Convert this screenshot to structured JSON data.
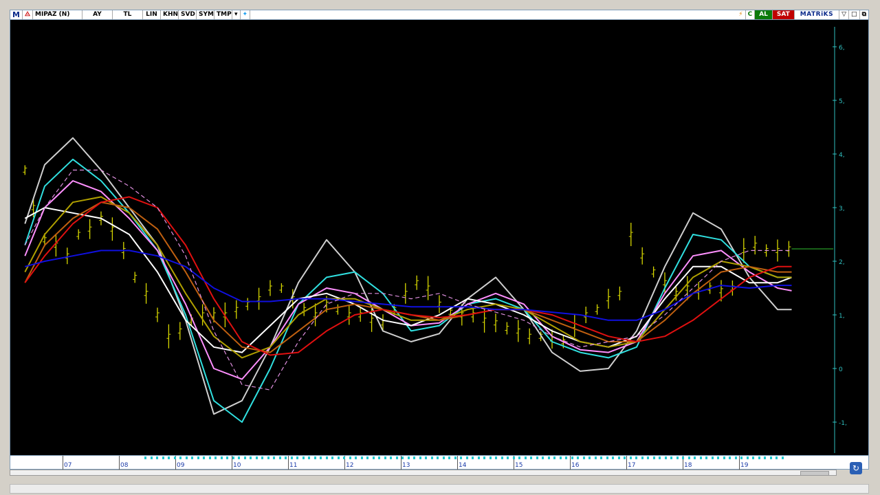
{
  "toolbar": {
    "logo": "M",
    "symbol": "MIPAZ (N)",
    "period": "AY",
    "currency": "TL",
    "buttons": [
      "LIN",
      "KHN",
      "SVD",
      "SYM",
      "TMP"
    ],
    "buy": "AL",
    "sell": "SAT",
    "brand": "MATRiKS"
  },
  "colors": {
    "bars": "#d8d800",
    "red": "#e01010",
    "blue": "#1010e0",
    "cyan": "#30e0e0",
    "white": "#ffffff",
    "gray": "#cfcfcf",
    "pink": "#ff90ff",
    "olive": "#b0a000",
    "brown": "#c06010",
    "dashed": "#e090e0",
    "axis": "#30c0c0",
    "lastvalue": "#30c030"
  },
  "x_labels": [
    "07",
    "08",
    "09",
    "10",
    "11",
    "12",
    "13",
    "14",
    "15",
    "16",
    "17",
    "18",
    "19"
  ],
  "chart_data": {
    "type": "line",
    "ylim": [
      -1.5,
      6.8
    ],
    "y_ticks": [
      "6,",
      "5,",
      "4,",
      "3,",
      "2,",
      "1,",
      "0",
      "-1,"
    ],
    "y_tick_values": [
      6,
      5,
      4,
      3,
      2,
      1,
      0,
      -1
    ],
    "x_range": [
      6.1,
      19.8
    ],
    "last_value": 2.23,
    "price": {
      "x": [
        6.15,
        6.3,
        6.5,
        6.7,
        6.9,
        7.1,
        7.3,
        7.5,
        7.7,
        7.9,
        8.1,
        8.3,
        8.5,
        8.7,
        8.9,
        9.1,
        9.3,
        9.5,
        9.7,
        9.9,
        10.1,
        10.3,
        10.5,
        10.7,
        10.9,
        11.1,
        11.3,
        11.5,
        11.7,
        11.9,
        12.1,
        12.3,
        12.5,
        12.7,
        12.9,
        13.1,
        13.3,
        13.5,
        13.7,
        13.9,
        14.1,
        14.3,
        14.5,
        14.7,
        14.9,
        15.1,
        15.3,
        15.5,
        15.7,
        15.9,
        16.1,
        16.3,
        16.5,
        16.7,
        16.9,
        17.1,
        17.3,
        17.5,
        17.7,
        17.9,
        18.1,
        18.3,
        18.5,
        18.7,
        18.9,
        19.1,
        19.3,
        19.5,
        19.7
      ],
      "y": [
        3.7,
        3.0,
        2.4,
        2.3,
        2.1,
        2.5,
        2.6,
        2.8,
        2.6,
        2.2,
        1.7,
        1.4,
        1.0,
        0.6,
        0.7,
        0.9,
        1.0,
        1.0,
        1.0,
        1.1,
        1.2,
        1.3,
        1.5,
        1.5,
        1.3,
        1.1,
        1.0,
        1.2,
        1.1,
        1.0,
        1.0,
        0.9,
        0.85,
        1.1,
        1.4,
        1.6,
        1.5,
        1.2,
        1.05,
        1.0,
        1.0,
        0.9,
        0.85,
        0.75,
        0.7,
        0.6,
        0.6,
        0.55,
        0.5,
        0.8,
        1.0,
        1.1,
        1.3,
        1.4,
        2.5,
        2.1,
        1.8,
        1.6,
        1.4,
        1.5,
        1.45,
        1.5,
        1.45,
        1.5,
        2.2,
        2.3,
        2.2,
        2.2,
        2.23
      ]
    },
    "series": [
      {
        "color_key": "gray",
        "x": [
          6.15,
          6.5,
          7.0,
          7.5,
          8.0,
          8.5,
          9.0,
          9.5,
          10.0,
          10.5,
          11.0,
          11.5,
          12.0,
          12.5,
          13.0,
          13.5,
          14.0,
          14.5,
          15.0,
          15.5,
          16.0,
          16.5,
          17.0,
          17.5,
          18.0,
          18.5,
          19.0,
          19.5,
          19.75
        ],
        "y": [
          2.7,
          3.8,
          4.3,
          3.7,
          3.0,
          2.3,
          0.9,
          -0.85,
          -0.6,
          0.4,
          1.6,
          2.4,
          1.8,
          0.7,
          0.5,
          0.65,
          1.3,
          1.7,
          1.1,
          0.3,
          -0.05,
          0.0,
          0.7,
          1.9,
          2.9,
          2.6,
          1.7,
          1.1,
          1.1
        ]
      },
      {
        "color_key": "cyan",
        "x": [
          6.15,
          6.5,
          7.0,
          7.5,
          8.0,
          8.5,
          9.0,
          9.5,
          10.0,
          10.5,
          11.0,
          11.5,
          12.0,
          12.5,
          13.0,
          13.5,
          14.0,
          14.5,
          15.0,
          15.5,
          16.0,
          16.5,
          17.0,
          17.5,
          18.0,
          18.5,
          19.0,
          19.5,
          19.75
        ],
        "y": [
          2.3,
          3.4,
          3.9,
          3.5,
          2.9,
          2.2,
          1.0,
          -0.6,
          -1.0,
          0.0,
          1.2,
          1.7,
          1.8,
          1.4,
          0.7,
          0.8,
          1.2,
          1.3,
          1.1,
          0.5,
          0.3,
          0.2,
          0.4,
          1.5,
          2.5,
          2.4,
          1.9,
          1.7,
          1.7
        ]
      },
      {
        "color_key": "pink",
        "x": [
          6.15,
          6.5,
          7.0,
          7.5,
          8.0,
          8.5,
          9.0,
          9.5,
          10.0,
          10.5,
          11.0,
          11.5,
          12.0,
          12.5,
          13.0,
          13.5,
          14.0,
          14.5,
          15.0,
          15.5,
          16.0,
          16.5,
          17.0,
          17.5,
          18.0,
          18.5,
          19.0,
          19.5,
          19.75
        ],
        "y": [
          2.1,
          3.0,
          3.5,
          3.3,
          2.8,
          2.2,
          1.2,
          0.0,
          -0.2,
          0.4,
          1.2,
          1.5,
          1.4,
          1.1,
          0.8,
          0.85,
          1.2,
          1.4,
          1.2,
          0.6,
          0.35,
          0.3,
          0.5,
          1.4,
          2.1,
          2.2,
          1.8,
          1.5,
          1.45
        ]
      },
      {
        "color_key": "white",
        "x": [
          6.15,
          6.5,
          7.0,
          7.5,
          8.0,
          8.5,
          9.0,
          9.5,
          10.0,
          10.5,
          11.0,
          11.5,
          12.0,
          12.5,
          13.0,
          13.5,
          14.0,
          14.5,
          15.0,
          15.5,
          16.0,
          16.5,
          17.0,
          17.5,
          18.0,
          18.5,
          19.0,
          19.5,
          19.75
        ],
        "y": [
          2.8,
          3.0,
          2.9,
          2.8,
          2.5,
          1.8,
          0.9,
          0.4,
          0.3,
          0.8,
          1.3,
          1.4,
          1.2,
          0.9,
          0.8,
          1.0,
          1.3,
          1.2,
          1.0,
          0.7,
          0.5,
          0.4,
          0.6,
          1.3,
          1.9,
          1.9,
          1.6,
          1.6,
          1.7
        ]
      },
      {
        "color_key": "olive",
        "x": [
          6.15,
          6.5,
          7.0,
          7.5,
          8.0,
          8.5,
          9.0,
          9.5,
          10.0,
          10.5,
          11.0,
          11.5,
          12.0,
          12.5,
          13.0,
          13.5,
          14.0,
          14.5,
          15.0,
          15.5,
          16.0,
          16.5,
          17.0,
          17.5,
          18.0,
          18.5,
          19.0,
          19.5,
          19.75
        ],
        "y": [
          1.8,
          2.5,
          3.1,
          3.2,
          2.9,
          2.3,
          1.4,
          0.6,
          0.2,
          0.4,
          1.0,
          1.3,
          1.3,
          1.1,
          0.9,
          0.9,
          1.1,
          1.2,
          1.1,
          0.8,
          0.5,
          0.4,
          0.5,
          1.1,
          1.7,
          2.0,
          1.9,
          1.7,
          1.7
        ]
      },
      {
        "color_key": "brown",
        "x": [
          6.15,
          6.5,
          7.0,
          7.5,
          8.0,
          8.5,
          9.0,
          9.5,
          10.0,
          10.5,
          11.0,
          11.5,
          12.0,
          12.5,
          13.0,
          13.5,
          14.0,
          14.5,
          15.0,
          15.5,
          16.0,
          16.5,
          17.0,
          17.5,
          18.0,
          18.5,
          19.0,
          19.5,
          19.75
        ],
        "y": [
          1.6,
          2.3,
          2.8,
          3.1,
          3.0,
          2.6,
          1.8,
          0.9,
          0.4,
          0.3,
          0.7,
          1.1,
          1.2,
          1.1,
          1.0,
          0.9,
          1.0,
          1.1,
          1.1,
          0.9,
          0.7,
          0.5,
          0.5,
          0.9,
          1.4,
          1.8,
          1.9,
          1.8,
          1.8
        ]
      },
      {
        "color_key": "red",
        "x": [
          6.15,
          6.5,
          7.0,
          7.5,
          8.0,
          8.5,
          9.0,
          9.5,
          10.0,
          10.5,
          11.0,
          11.5,
          12.0,
          12.5,
          13.0,
          13.5,
          14.0,
          14.5,
          15.0,
          15.5,
          16.0,
          16.5,
          17.0,
          17.5,
          18.0,
          18.5,
          19.0,
          19.5,
          19.75
        ],
        "y": [
          1.6,
          2.1,
          2.7,
          3.1,
          3.2,
          3.0,
          2.3,
          1.3,
          0.5,
          0.25,
          0.3,
          0.7,
          1.0,
          1.1,
          1.0,
          0.95,
          1.0,
          1.1,
          1.1,
          1.0,
          0.8,
          0.6,
          0.5,
          0.6,
          0.9,
          1.3,
          1.7,
          1.9,
          1.9
        ]
      },
      {
        "color_key": "blue",
        "x": [
          6.15,
          6.5,
          7.0,
          7.5,
          8.0,
          8.5,
          9.0,
          9.5,
          10.0,
          10.5,
          11.0,
          11.5,
          12.0,
          12.5,
          13.0,
          13.5,
          14.0,
          14.5,
          15.0,
          15.5,
          16.0,
          16.5,
          17.0,
          17.5,
          18.0,
          18.5,
          19.0,
          19.5,
          19.75
        ],
        "y": [
          1.9,
          2.0,
          2.1,
          2.2,
          2.2,
          2.1,
          1.9,
          1.5,
          1.25,
          1.25,
          1.3,
          1.3,
          1.25,
          1.2,
          1.15,
          1.15,
          1.15,
          1.1,
          1.1,
          1.05,
          1.0,
          0.9,
          0.9,
          1.1,
          1.4,
          1.55,
          1.5,
          1.55,
          1.55
        ]
      },
      {
        "color_key": "dashed",
        "dashed": true,
        "x": [
          6.15,
          6.5,
          7.0,
          7.5,
          8.0,
          8.5,
          9.0,
          9.5,
          10.0,
          10.5,
          11.0,
          11.5,
          12.0,
          12.5,
          13.0,
          13.5,
          14.0,
          14.5,
          15.0,
          15.5,
          16.0,
          16.5,
          17.0,
          17.5,
          18.0,
          18.5,
          19.0,
          19.5,
          19.75
        ],
        "y": [
          2.3,
          3.0,
          3.7,
          3.7,
          3.4,
          3.0,
          2.1,
          0.7,
          -0.3,
          -0.4,
          0.5,
          1.2,
          1.4,
          1.4,
          1.3,
          1.4,
          1.2,
          1.05,
          0.9,
          0.6,
          0.4,
          0.5,
          0.6,
          1.0,
          1.5,
          2.0,
          2.2,
          2.2,
          2.2
        ]
      }
    ]
  }
}
